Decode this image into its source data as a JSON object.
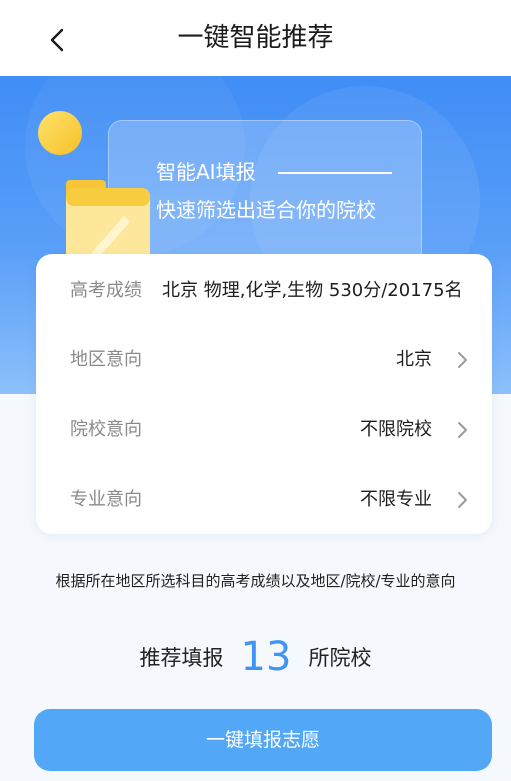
{
  "header": {
    "back_icon": "chevron-left-icon",
    "title": "一键智能推荐"
  },
  "banner": {
    "line1": "智能AI填报",
    "line2": "快速筛选出适合你的院校"
  },
  "info": {
    "score": {
      "label": "高考成绩",
      "value": "北京 物理,化学,生物 530分/20175名"
    },
    "region": {
      "label": "地区意向",
      "value": "北京"
    },
    "school": {
      "label": "院校意向",
      "value": "不限院校"
    },
    "major": {
      "label": "专业意向",
      "value": "不限专业"
    }
  },
  "description": "根据所在地区所选科目的高考成绩以及地区/院校/专业的意向",
  "recommend": {
    "prefix": "推荐填报",
    "count": "13",
    "suffix": "所院校"
  },
  "submit_label": "一键填报志愿",
  "colors": {
    "accent": "#3f95f6",
    "button": "#52a8f7",
    "banner_top": "#3f8df6"
  }
}
